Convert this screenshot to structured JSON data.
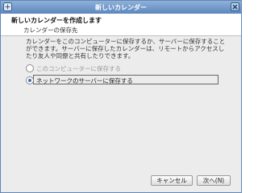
{
  "window": {
    "title": "新しいカレンダー"
  },
  "header": {
    "title": "新しいカレンダーを作成します",
    "subtitle": "カレンダーの保存先"
  },
  "content": {
    "description": "カレンダーをこのコンピューターに保存するか、サーバーに保存することができます。サーバーに保存したカレンダーは、リモートからアクセスしたり友人や同僚と共有したりできます。",
    "options": [
      {
        "label": "このコンピューターに保存する",
        "selected": false
      },
      {
        "label": "ネットワークのサーバーに保存する",
        "selected": true
      }
    ]
  },
  "buttons": {
    "cancel_label": "キャンセル",
    "next_label": "次へ(N)"
  },
  "colors": {
    "titlebar": "#6f96c9",
    "accent": "#3f6fb0"
  }
}
